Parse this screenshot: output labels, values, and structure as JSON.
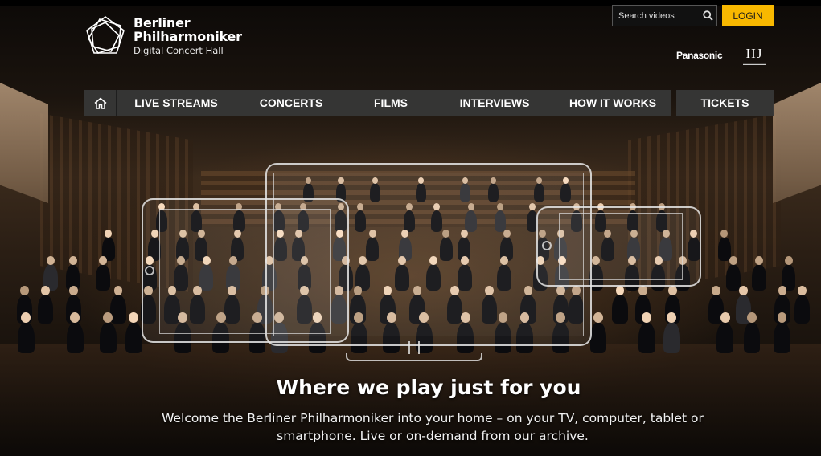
{
  "brand": {
    "line1": "Berliner",
    "line2": "Philharmoniker",
    "line3": "Digital Concert Hall"
  },
  "search": {
    "placeholder": "Search videos",
    "icon": "search-icon"
  },
  "login_label": "LOGIN",
  "sponsors": {
    "panasonic": "Panasonic",
    "iij": "IIJ"
  },
  "nav": {
    "home_icon": "home-icon",
    "items": [
      "LIVE STREAMS",
      "CONCERTS",
      "FILMS",
      "INTERVIEWS",
      "HOW IT WORKS",
      "TICKETS"
    ]
  },
  "hero": {
    "headline": "Where we play just for you",
    "subline": "Welcome the Berliner Philharmoniker into your home – on your TV, computer, tablet or smartphone. Live or on-demand from our archive."
  },
  "colors": {
    "login": "#f8b800",
    "nav_bg": "#373737",
    "background": "#000000"
  }
}
